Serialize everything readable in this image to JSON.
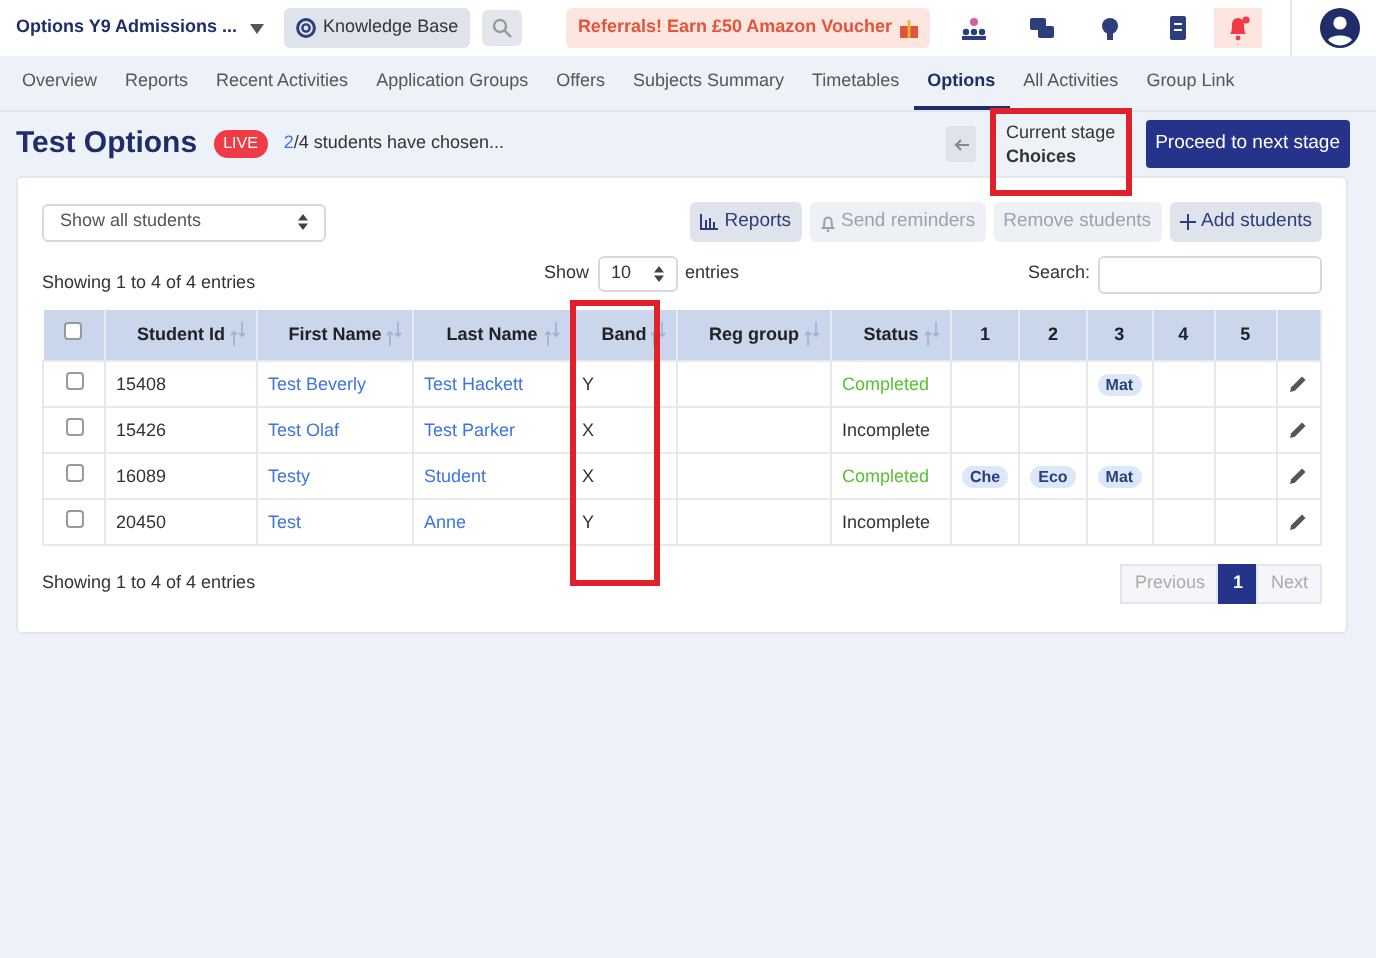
{
  "topbar": {
    "app_title": "Options Y9 Admissions ...",
    "knowledge_base": "Knowledge Base",
    "referral": "Referrals! Earn £50 Amazon Voucher"
  },
  "tabs": [
    {
      "label": "Overview",
      "selected": false
    },
    {
      "label": "Reports",
      "selected": false
    },
    {
      "label": "Recent Activities",
      "selected": false
    },
    {
      "label": "Application Groups",
      "selected": false
    },
    {
      "label": "Offers",
      "selected": false
    },
    {
      "label": "Subjects Summary",
      "selected": false
    },
    {
      "label": "Timetables",
      "selected": false
    },
    {
      "label": "Options",
      "selected": true
    },
    {
      "label": "All Activities",
      "selected": false
    },
    {
      "label": "Group Link",
      "selected": false
    }
  ],
  "page": {
    "title": "Test Options",
    "badge": "LIVE",
    "chosen_count": "2",
    "chosen_rest": "/4 students have chosen...",
    "stage_label": "Current stage",
    "stage_value": "Choices",
    "stage_highlighted": true,
    "proceed_button": "Proceed to next stage"
  },
  "filter": {
    "value": "Show all students"
  },
  "actions": [
    {
      "label": "Reports",
      "disabled": false
    },
    {
      "label": "Send reminders",
      "disabled": true
    },
    {
      "label": "Remove students",
      "disabled": true
    },
    {
      "label": "Add students",
      "disabled": false
    }
  ],
  "info_top": "Showing 1 to 4 of 4 entries",
  "show_label": "Show",
  "page_size": "10",
  "entries_label": "entries",
  "search_label": "Search:",
  "table": {
    "select_all_checked": false,
    "columns": [
      {
        "label": "Student Id",
        "sortable": true,
        "highlighted": false
      },
      {
        "label": "First Name",
        "sortable": true,
        "highlighted": false
      },
      {
        "label": "Last Name",
        "sortable": true,
        "highlighted": false
      },
      {
        "label": "Band",
        "sortable": true,
        "highlighted": true
      },
      {
        "label": "Reg group",
        "sortable": true,
        "highlighted": false
      },
      {
        "label": "Status",
        "sortable": true,
        "highlighted": false
      },
      {
        "label": "1",
        "sortable": false,
        "highlighted": false
      },
      {
        "label": "2",
        "sortable": false,
        "highlighted": false
      },
      {
        "label": "3",
        "sortable": false,
        "highlighted": false
      },
      {
        "label": "4",
        "sortable": false,
        "highlighted": false
      },
      {
        "label": "5",
        "sortable": false,
        "highlighted": false
      }
    ],
    "rows": [
      {
        "checked": false,
        "id": "15408",
        "first": "Test Beverly",
        "last": "Test Hackett",
        "band": "Y",
        "status": "Completed",
        "completed": true,
        "choice_3": "Mat"
      },
      {
        "checked": false,
        "id": "15426",
        "first": "Test Olaf",
        "last": "Test Parker",
        "band": "X",
        "status": "Incomplete",
        "completed": false
      },
      {
        "checked": false,
        "id": "16089",
        "first": "Testy",
        "last": "Student",
        "band": "X",
        "status": "Completed",
        "completed": true,
        "choice_1": "Che",
        "choice_2": "Eco",
        "choice_3": "Mat"
      },
      {
        "checked": false,
        "id": "20450",
        "first": "Test",
        "last": "Anne",
        "band": "Y",
        "status": "Incomplete",
        "completed": false
      }
    ]
  },
  "info_bottom": "Showing 1 to 4 of 4 entries",
  "pagination": [
    {
      "label": "Previous",
      "selected": false,
      "disabled": true
    },
    {
      "label": "1",
      "selected": true,
      "disabled": false
    },
    {
      "label": "Next",
      "selected": false,
      "disabled": true
    }
  ]
}
